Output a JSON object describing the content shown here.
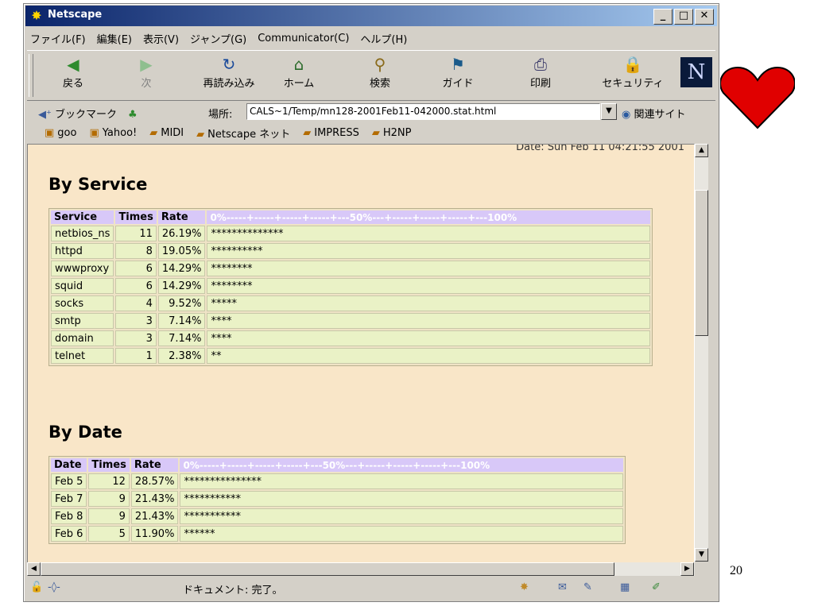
{
  "window": {
    "title": "Netscape",
    "min": "_",
    "max": "□",
    "close": "✕"
  },
  "menu": [
    "ファイル(F)",
    "編集(E)",
    "表示(V)",
    "ジャンプ(G)",
    "Communicator(C)",
    "ヘルプ(H)"
  ],
  "toolbar": [
    {
      "label": "戻る",
      "icon": "back-arrow-icon",
      "glyph": "◀",
      "enabled": true
    },
    {
      "label": "次",
      "icon": "forward-arrow-icon",
      "glyph": "▶",
      "enabled": false
    },
    {
      "label": "再読み込み",
      "icon": "reload-icon",
      "glyph": "↻",
      "enabled": true
    },
    {
      "label": "ホーム",
      "icon": "home-icon",
      "glyph": "⌂",
      "enabled": true
    },
    {
      "label": "検索",
      "icon": "search-icon",
      "glyph": "⚲",
      "enabled": true
    },
    {
      "label": "ガイド",
      "icon": "guide-icon",
      "glyph": "⚑",
      "enabled": true
    },
    {
      "label": "印刷",
      "icon": "print-icon",
      "glyph": "⎙",
      "enabled": true
    },
    {
      "label": "セキュリティ",
      "icon": "lock-icon",
      "glyph": "🔒",
      "enabled": true
    }
  ],
  "logo": "N",
  "location": {
    "bookmarks": "ブックマーク",
    "label": "場所:",
    "url": "CALS~1/Temp/mn128-2001Feb11-042000.stat.html",
    "related": "関連サイト"
  },
  "personal": [
    "goo",
    "Yahoo!",
    "MIDI",
    "Netscape ネット",
    "IMPRESS",
    "H2NP"
  ],
  "page": {
    "date_line": "Date: Sun Feb 11 04:21:55 2001",
    "service_heading": "By Service",
    "service_headers": [
      "Service",
      "Times",
      "Rate"
    ],
    "service_scale": "0%-----+-----+-----+-----+---50%---+-----+-----+-----+---100%",
    "services": [
      {
        "name": "netbios_ns",
        "times": "11",
        "rate": "26.19%",
        "bar": "**************"
      },
      {
        "name": "httpd",
        "times": "8",
        "rate": "19.05%",
        "bar": "**********"
      },
      {
        "name": "wwwproxy",
        "times": "6",
        "rate": "14.29%",
        "bar": "********"
      },
      {
        "name": "squid",
        "times": "6",
        "rate": "14.29%",
        "bar": "********"
      },
      {
        "name": "socks",
        "times": "4",
        "rate": "9.52%",
        "bar": "*****"
      },
      {
        "name": "smtp",
        "times": "3",
        "rate": "7.14%",
        "bar": "****"
      },
      {
        "name": "domain",
        "times": "3",
        "rate": "7.14%",
        "bar": "****"
      },
      {
        "name": "telnet",
        "times": "1",
        "rate": "2.38%",
        "bar": "**"
      }
    ],
    "date_heading": "By Date",
    "date_headers": [
      "Date",
      "Times",
      "Rate"
    ],
    "date_scale": "0%-----+-----+-----+-----+---50%---+-----+-----+-----+---100%",
    "dates": [
      {
        "name": "Feb 5",
        "times": "12",
        "rate": "28.57%",
        "bar": "***************"
      },
      {
        "name": "Feb 7",
        "times": "9",
        "rate": "21.43%",
        "bar": "***********"
      },
      {
        "name": "Feb 8",
        "times": "9",
        "rate": "21.43%",
        "bar": "***********"
      },
      {
        "name": "Feb 6",
        "times": "5",
        "rate": "11.90%",
        "bar": "******"
      }
    ]
  },
  "status": "ドキュメント: 完了。",
  "slide_number": "20",
  "colors": {
    "page_bg": "#f9e6c8",
    "header_bg": "#d8c8f8",
    "cell_bg": "#eaf2c6",
    "heart": "#e00000"
  }
}
